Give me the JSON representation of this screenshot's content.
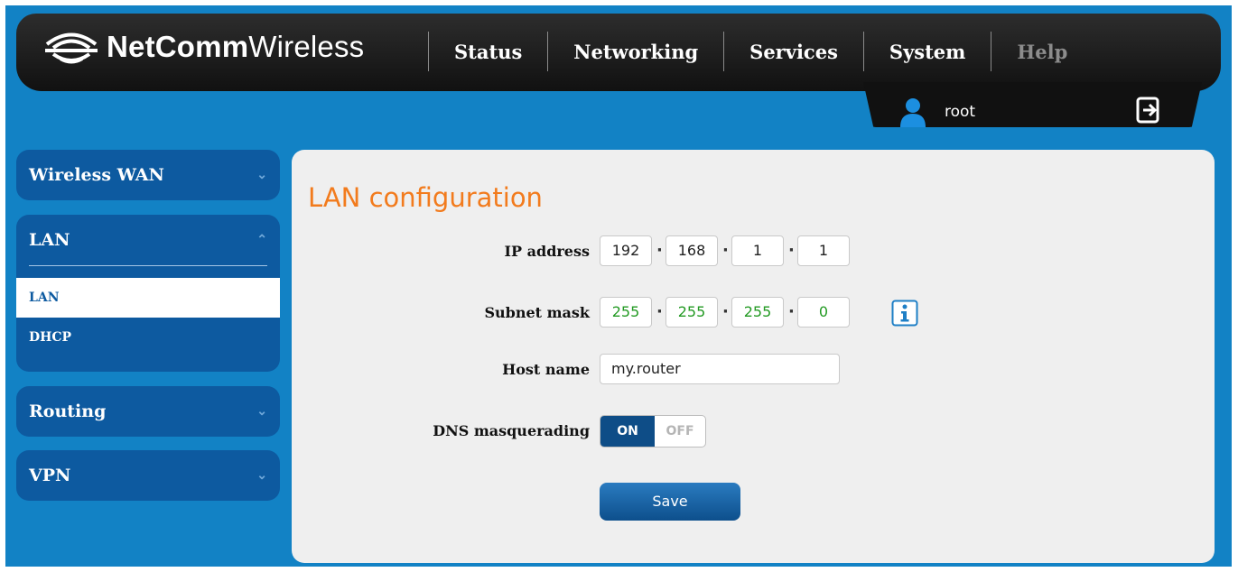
{
  "brand": {
    "name_bold": "NetComm",
    "name_light": "Wireless"
  },
  "nav": {
    "items": [
      "Status",
      "Networking",
      "Services",
      "System",
      "Help"
    ]
  },
  "user": {
    "name": "root"
  },
  "sidebar": {
    "sections": [
      {
        "label": "Wireless WAN",
        "expanded": false
      },
      {
        "label": "LAN",
        "expanded": true,
        "subitems": [
          "LAN",
          "DHCP"
        ],
        "active": "LAN"
      },
      {
        "label": "Routing",
        "expanded": false
      },
      {
        "label": "VPN",
        "expanded": false
      }
    ],
    "chevron_down": "⌄",
    "chevron_up": "⌃"
  },
  "main": {
    "title": "LAN configuration",
    "ip_label": "IP address",
    "ip": [
      "192",
      "168",
      "1",
      "1"
    ],
    "subnet_label": "Subnet mask",
    "subnet": [
      "255",
      "255",
      "255",
      "0"
    ],
    "host_label": "Host name",
    "host_value": "my.router",
    "dns_label": "DNS masquerading",
    "dns_on": "ON",
    "dns_off": "OFF",
    "save_label": "Save"
  },
  "colors": {
    "background": "#1282c5",
    "sidebar": "#0d5aa0",
    "title": "#f27b1d",
    "subnet_text": "#239a23"
  }
}
